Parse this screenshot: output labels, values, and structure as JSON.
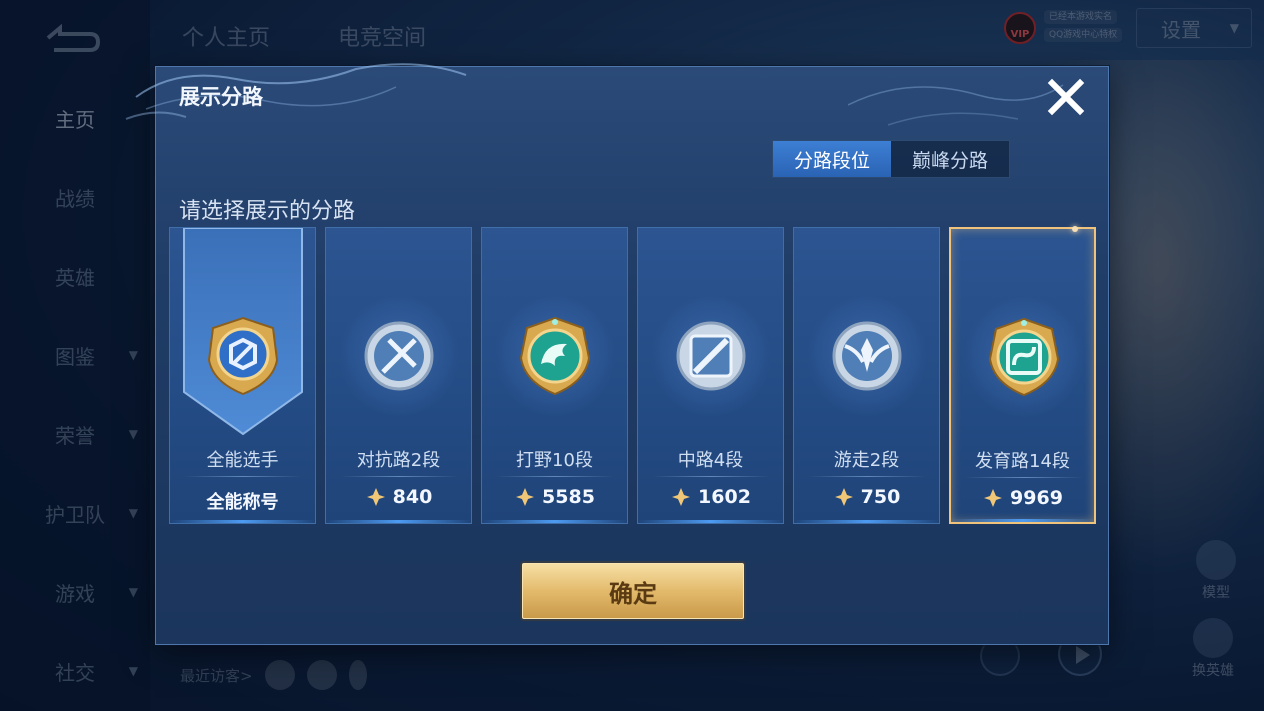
{
  "app": {
    "top_tabs": [
      "个人主页",
      "电竞空间"
    ],
    "settings_label": "设置",
    "vip_label": "VIP",
    "vip_chips": [
      "已经本游戏实名",
      "QQ游戏中心特权"
    ],
    "sidebar": [
      {
        "label": "主页",
        "has_chevron": false,
        "active": true
      },
      {
        "label": "战绩",
        "has_chevron": false,
        "active": false
      },
      {
        "label": "英雄",
        "has_chevron": false,
        "active": false
      },
      {
        "label": "图鉴",
        "has_chevron": true,
        "active": false
      },
      {
        "label": "荣誉",
        "has_chevron": true,
        "active": false
      },
      {
        "label": "护卫队",
        "has_chevron": true,
        "active": false
      },
      {
        "label": "游戏",
        "has_chevron": true,
        "active": false
      },
      {
        "label": "社交",
        "has_chevron": true,
        "active": false
      }
    ],
    "recent_visitors_label": "最近访客>",
    "right_buttons": [
      "模型",
      "换英雄"
    ]
  },
  "modal": {
    "title": "展示分路",
    "tabs": [
      {
        "label": "分路段位",
        "active": true
      },
      {
        "label": "巅峰分路",
        "active": false
      }
    ],
    "subtitle": "请选择展示的分路",
    "cards": [
      {
        "label": "全能选手",
        "value": "全能称号",
        "type": "title",
        "icon": "all-round-emblem-icon",
        "selected": false
      },
      {
        "label": "对抗路2段",
        "value": "840",
        "type": "score",
        "icon": "clash-lane-emblem-icon",
        "selected": false
      },
      {
        "label": "打野10段",
        "value": "5585",
        "type": "score",
        "icon": "jungle-emblem-icon",
        "selected": false
      },
      {
        "label": "中路4段",
        "value": "1602",
        "type": "score",
        "icon": "mid-lane-emblem-icon",
        "selected": false
      },
      {
        "label": "游走2段",
        "value": "750",
        "type": "score",
        "icon": "roam-emblem-icon",
        "selected": false
      },
      {
        "label": "发育路14段",
        "value": "9969",
        "type": "score",
        "icon": "farm-lane-emblem-icon",
        "selected": true
      }
    ],
    "confirm_label": "确定"
  },
  "colors": {
    "accent_blue": "#3d7fd4",
    "gold": "#e3ba6c",
    "selected_border": "#f0c37c",
    "emblem_gold": "#d9a94f",
    "emblem_silver": "#c9d6e6",
    "emblem_teal": "#1fa391"
  }
}
